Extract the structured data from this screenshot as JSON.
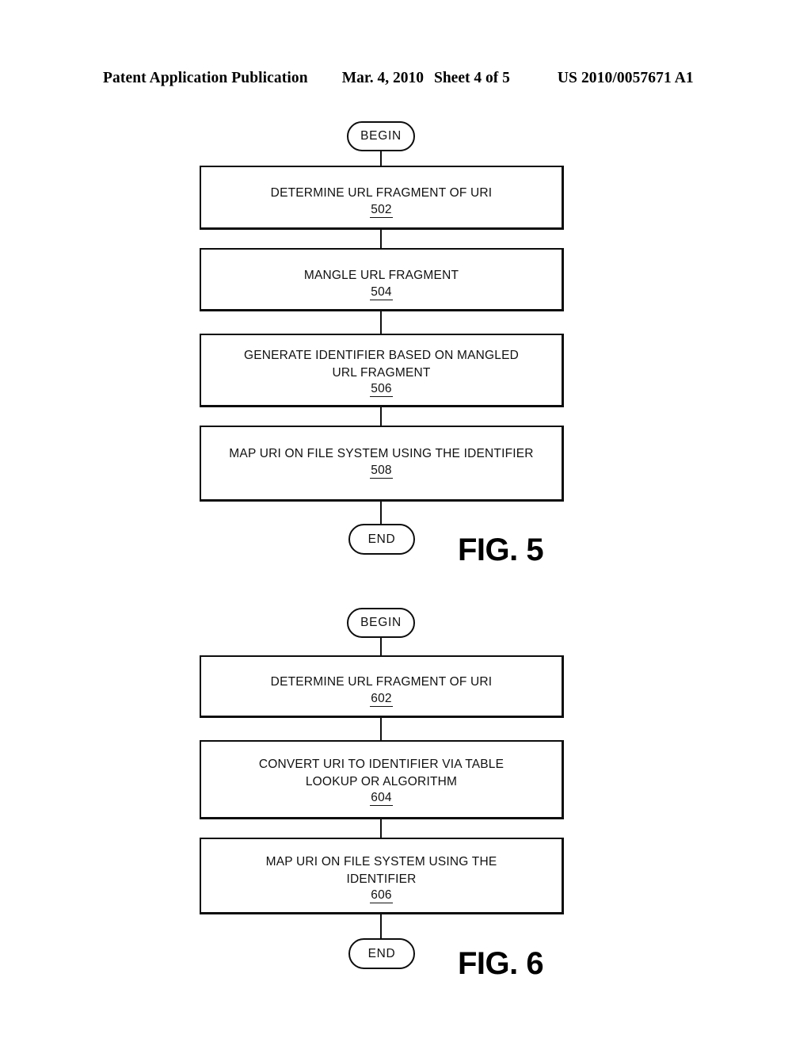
{
  "header": {
    "publication": "Patent Application Publication",
    "date": "Mar. 4, 2010",
    "sheet": "Sheet 4 of 5",
    "patent_number": "US 2010/0057671 A1"
  },
  "figures": [
    {
      "caption": "FIG. 5",
      "start_label": "BEGIN",
      "end_label": "END",
      "steps": [
        {
          "text": "DETERMINE URL FRAGMENT OF URI",
          "number": "502"
        },
        {
          "text": "MANGLE URL FRAGMENT",
          "number": "504"
        },
        {
          "text": "GENERATE IDENTIFIER BASED ON MANGLED\nURL FRAGMENT",
          "number": "506"
        },
        {
          "text": "MAP URI ON FILE SYSTEM USING THE IDENTIFIER",
          "number": "508"
        }
      ]
    },
    {
      "caption": "FIG. 6",
      "start_label": "BEGIN",
      "end_label": "END",
      "steps": [
        {
          "text": "DETERMINE URL FRAGMENT OF URI",
          "number": "602"
        },
        {
          "text": "CONVERT URI TO IDENTIFIER VIA TABLE\nLOOKUP OR ALGORITHM",
          "number": "604"
        },
        {
          "text": "MAP URI ON FILE SYSTEM USING THE\nIDENTIFIER",
          "number": "606"
        }
      ]
    }
  ],
  "colors": {
    "ink": "#111111",
    "paper": "#ffffff"
  }
}
